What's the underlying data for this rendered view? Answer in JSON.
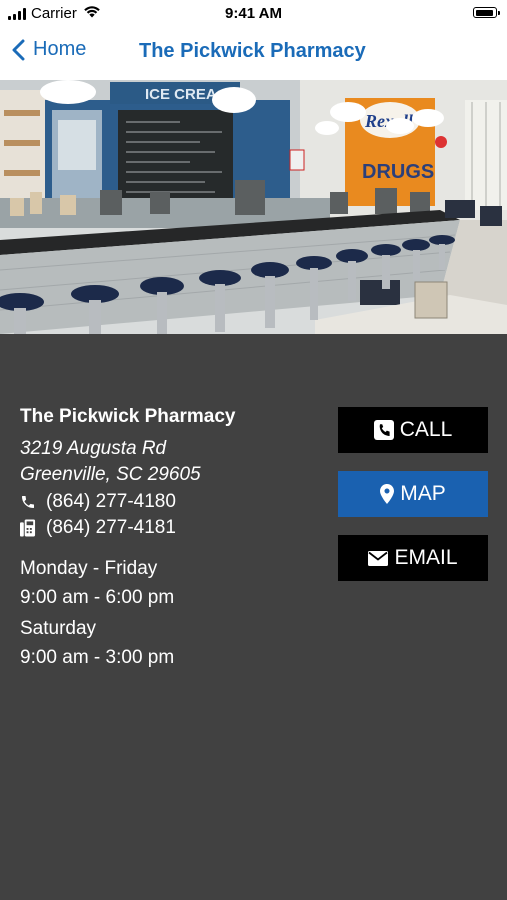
{
  "status_bar": {
    "carrier": "Carrier",
    "time": "9:41 AM"
  },
  "nav": {
    "back_label": "Home",
    "title": "The Pickwick Pharmacy"
  },
  "hero": {
    "icon": "pharmacy-interior-photo"
  },
  "business": {
    "name": "The Pickwick Pharmacy",
    "address_line1": "3219 Augusta Rd",
    "address_line2": "Greenville, SC 29605",
    "phone": "(864) 277-4180",
    "fax": "(864) 277-4181",
    "hours": [
      {
        "days": "Monday - Friday",
        "time": "9:00 am - 6:00 pm"
      },
      {
        "days": "Saturday",
        "time": "9:00 am - 3:00 pm"
      }
    ]
  },
  "actions": {
    "call_label": "CALL",
    "map_label": "MAP",
    "email_label": "EMAIL"
  },
  "colors": {
    "accent": "#1a6bb8",
    "map_button": "#1a61b0",
    "panel_background": "#414141"
  }
}
